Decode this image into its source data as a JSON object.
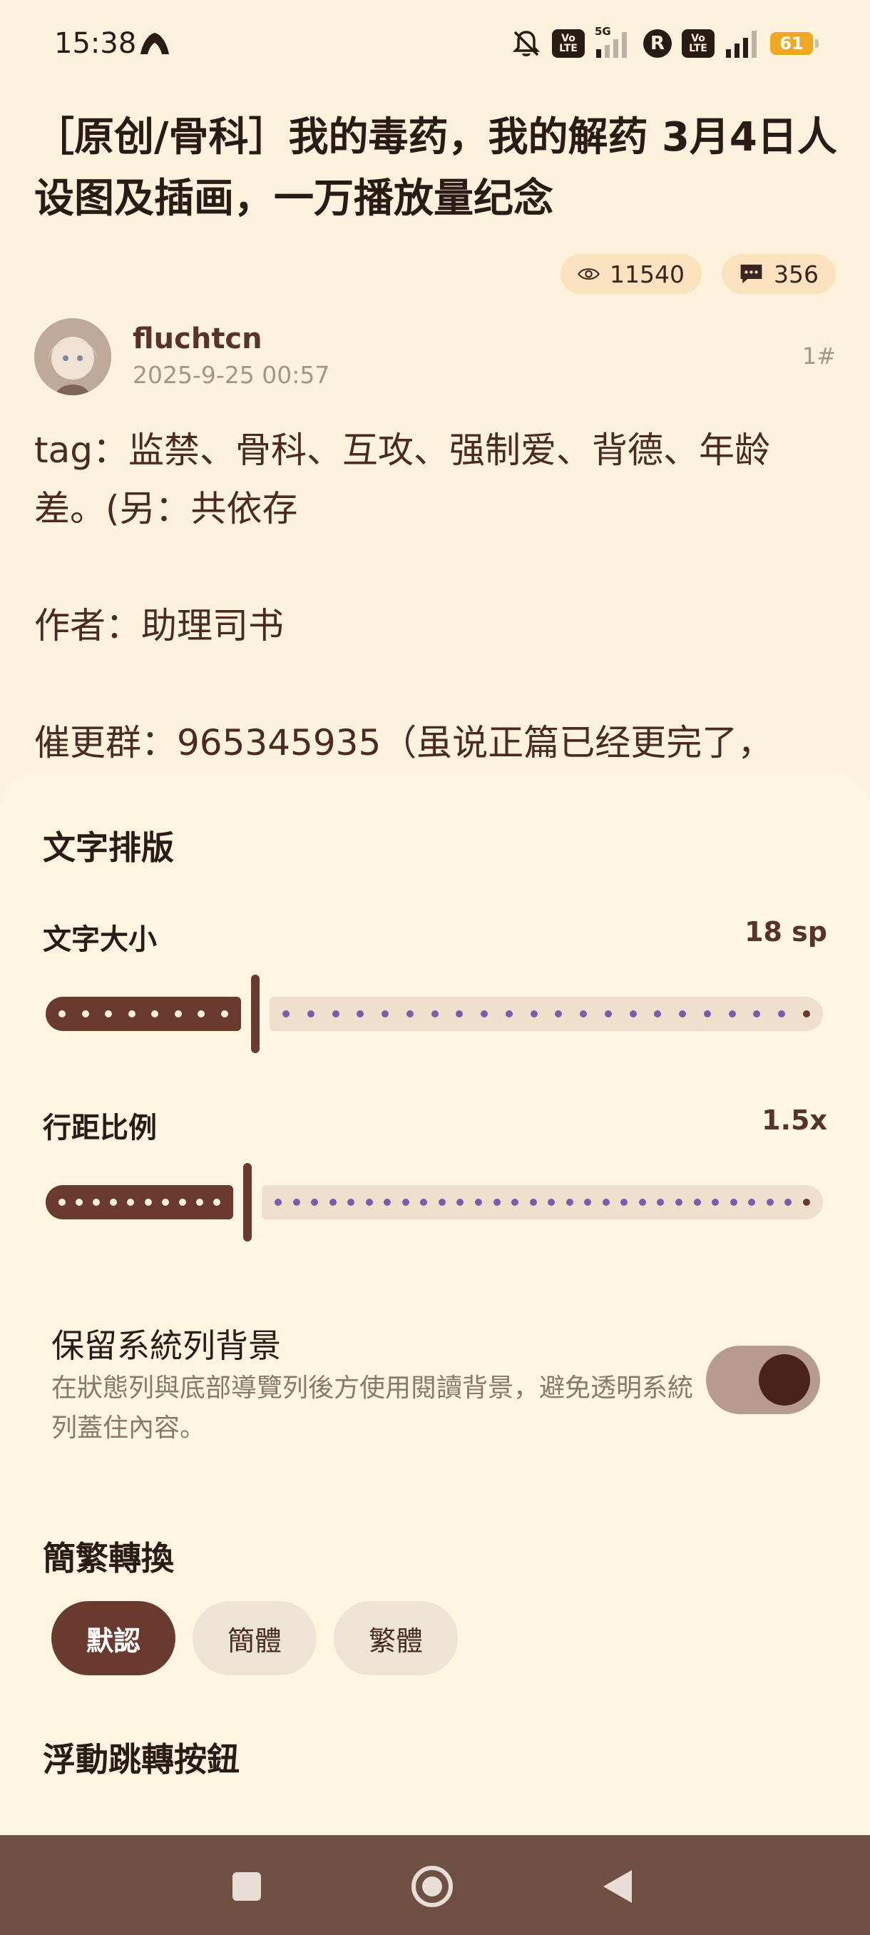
{
  "status_bar": {
    "time": "15:38",
    "network_label": "5G",
    "volte_label": "Vo LTE",
    "r_badge": "R",
    "battery": "61"
  },
  "article": {
    "title": "［原创/骨科］我的毒药，我的解药 3月4日人设图及插画，一万播放量纪念",
    "views": "11540",
    "comments": "356",
    "author": "fluchtcn",
    "date": "2025-9-25 00:57",
    "floor": "1#",
    "body_lines": [
      "tag：监禁、骨科、互攻、强制爱、背德、年龄差。(另：共依存",
      "",
      "作者：助理司书",
      "",
      "催更群：965345935（虽说正篇已经更完了，"
    ]
  },
  "settings": {
    "layout_title": "文字排版",
    "font_size": {
      "label": "文字大小",
      "value_text": "18 sp",
      "fraction": 0.27
    },
    "line_spacing": {
      "label": "行距比例",
      "value_text": "1.5x",
      "fraction": 0.26
    },
    "keep_system_bg": {
      "title": "保留系統列背景",
      "description": "在狀態列與底部導覽列後方使用閱讀背景，避免透明系統列蓋住內容。",
      "enabled": true
    },
    "conversion": {
      "title": "簡繁轉換",
      "options": [
        "默認",
        "簡體",
        "繁體"
      ],
      "selected": "默認"
    },
    "floating_button_title": "浮動跳轉按鈕"
  },
  "colors": {
    "background": "#fdf2dc",
    "sheet": "#fff6e2",
    "accent": "#6b3a2e",
    "nav_bar": "#6f5144"
  },
  "icons": [
    "app-notification-icon",
    "mute-bell-icon",
    "signal-icon",
    "eye-icon",
    "comment-icon",
    "square-nav-icon",
    "home-circle-nav-icon",
    "back-triangle-nav-icon"
  ]
}
